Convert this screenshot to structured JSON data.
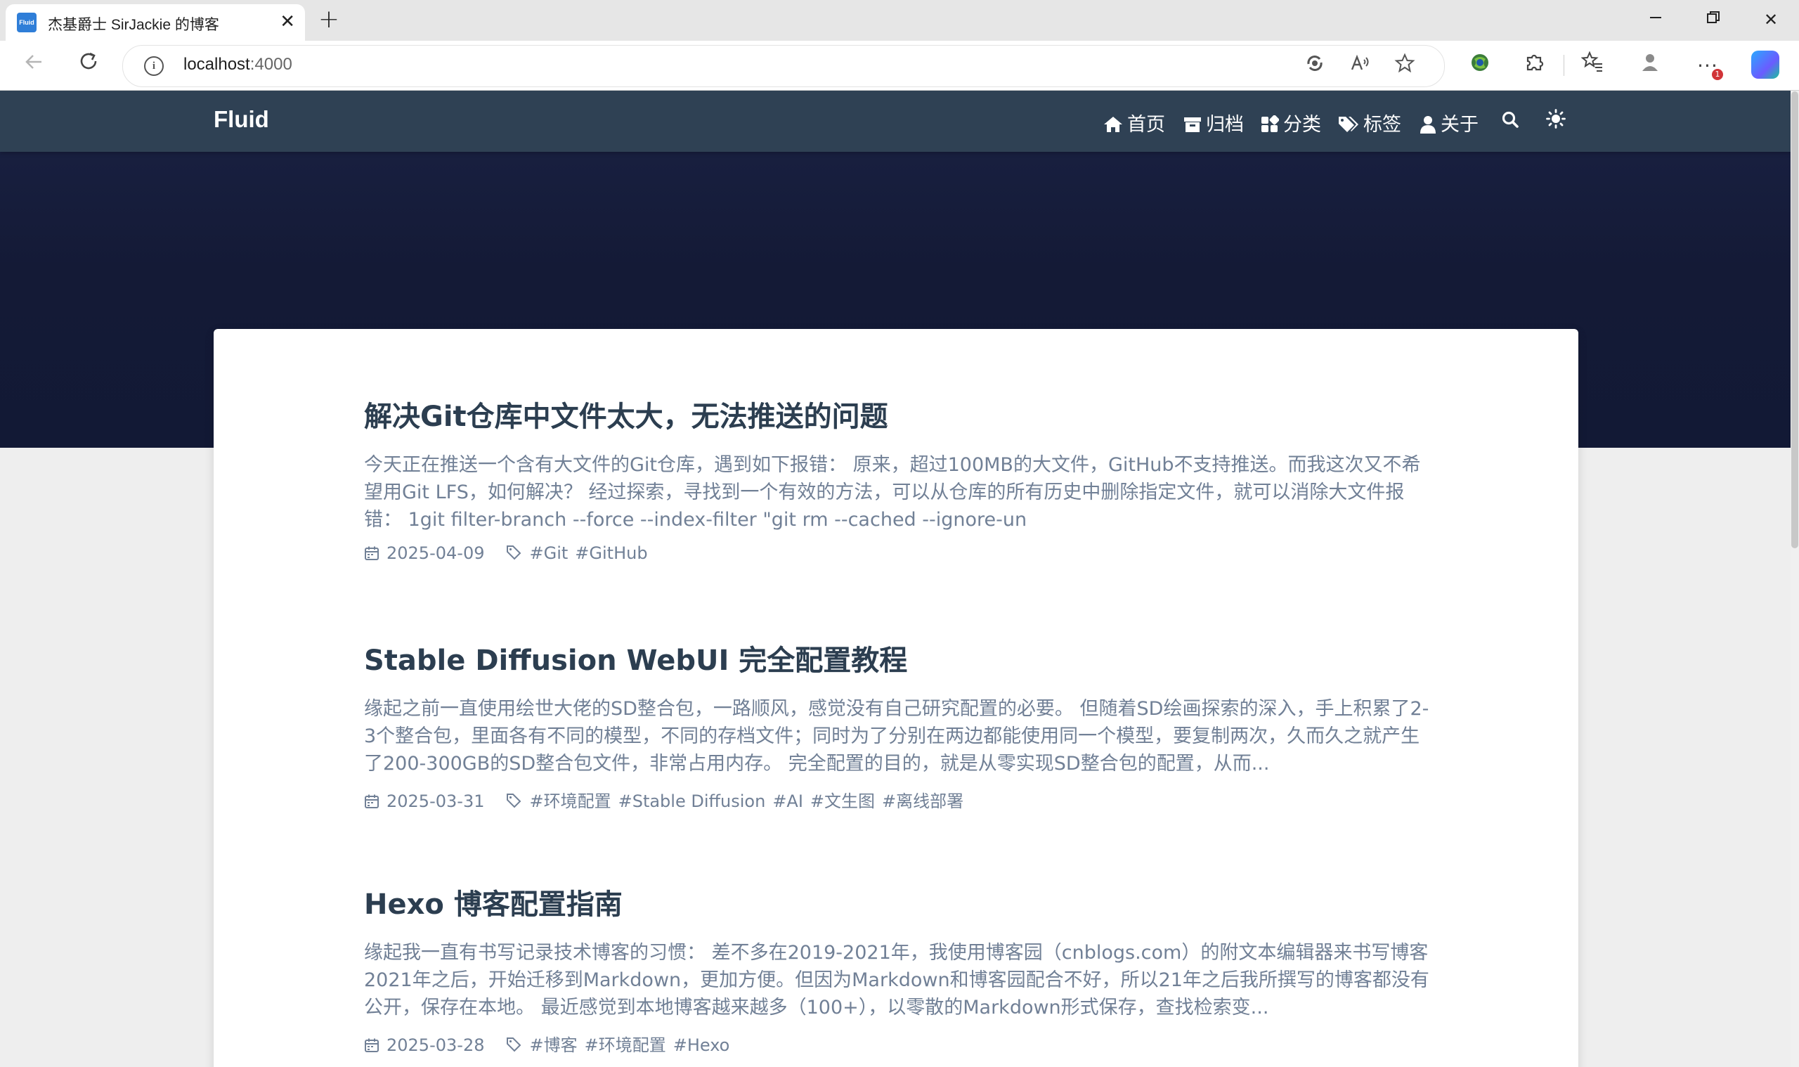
{
  "browser": {
    "tab_title": "杰基爵士 SirJackie 的博客",
    "tab_favicon_text": "Fluid",
    "url_host": "localhost",
    "url_port": ":4000",
    "notification_badge": "1"
  },
  "site": {
    "brand": "Fluid",
    "menu": [
      {
        "label": "首页",
        "icon": "home-icon"
      },
      {
        "label": "归档",
        "icon": "archive-icon"
      },
      {
        "label": "分类",
        "icon": "grid-icon"
      },
      {
        "label": "标签",
        "icon": "tags-icon"
      },
      {
        "label": "关于",
        "icon": "user-icon"
      }
    ]
  },
  "posts": [
    {
      "title": "解决Git仓库中文件太大，无法推送的问题",
      "excerpt": "今天正在推送一个含有大文件的Git仓库，遇到如下报错： 原来，超过100MB的大文件，GitHub不支持推送。而我这次又不希望用Git LFS，如何解决？ 经过探索，寻找到一个有效的方法，可以从仓库的所有历史中删除指定文件，就可以消除大文件报错： 1git filter-branch --force --index-filter \"git rm --cached --ignore-un",
      "date": "2025-04-09",
      "tags": [
        "#Git",
        "#GitHub"
      ]
    },
    {
      "title": "Stable Diffusion WebUI 完全配置教程",
      "excerpt": "缘起之前一直使用绘世大佬的SD整合包，一路顺风，感觉没有自己研究配置的必要。 但随着SD绘画探索的深入，手上积累了2-3个整合包，里面各有不同的模型，不同的存档文件；同时为了分别在两边都能使用同一个模型，要复制两次，久而久之就产生了200-300GB的SD整合包文件，非常占用内存。 完全配置的目的，就是从零实现SD整合包的配置，从而...",
      "date": "2025-03-31",
      "tags": [
        "#环境配置",
        "#Stable Diffusion",
        "#AI",
        "#文生图",
        "#离线部署"
      ]
    },
    {
      "title": "Hexo 博客配置指南",
      "excerpt": "缘起我一直有书写记录技术博客的习惯： 差不多在2019-2021年，我使用博客园（cnblogs.com）的附文本编辑器来书写博客 2021年之后，开始迁移到Markdown，更加方便。但因为Markdown和博客园配合不好，所以21年之后我所撰写的博客都没有公开，保存在本地。 最近感觉到本地博客越来越多（100+），以零散的Markdown形式保存，查找检索变...",
      "date": "2025-03-28",
      "tags": [
        "#博客",
        "#环境配置",
        "#Hexo"
      ]
    }
  ]
}
